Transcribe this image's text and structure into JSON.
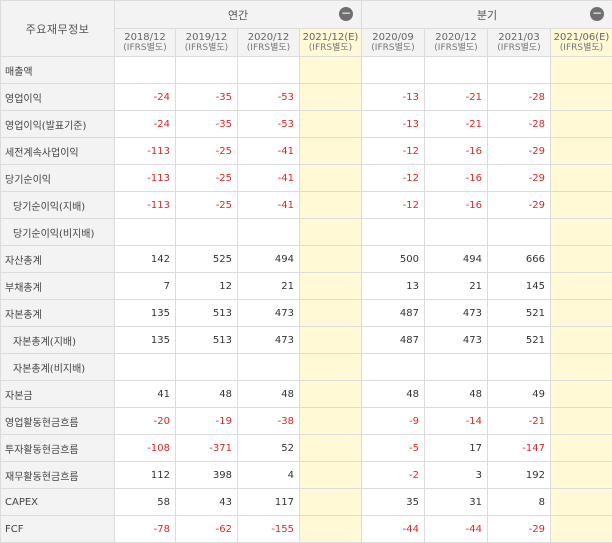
{
  "header": {
    "corner_label": "주요재무정보",
    "groups": [
      {
        "label": "연간",
        "collapse_icon": "minus-circle-icon"
      },
      {
        "label": "분기",
        "collapse_icon": "minus-circle-icon"
      }
    ],
    "periods": [
      {
        "date": "2018/12",
        "basis": "(IFRS별도)"
      },
      {
        "date": "2019/12",
        "basis": "(IFRS별도)"
      },
      {
        "date": "2020/12",
        "basis": "(IFRS별도)"
      },
      {
        "date": "2021/12(E)",
        "basis": "(IFRS별도)"
      },
      {
        "date": "2020/09",
        "basis": "(IFRS별도)"
      },
      {
        "date": "2020/12",
        "basis": "(IFRS별도)"
      },
      {
        "date": "2021/03",
        "basis": "(IFRS별도)"
      },
      {
        "date": "2021/06(E)",
        "basis": "(IFRS별도)"
      }
    ]
  },
  "rows": [
    {
      "label": "매출액",
      "indent": false,
      "values": [
        "",
        "",
        "",
        "",
        "",
        "",
        "",
        ""
      ]
    },
    {
      "label": "영업이익",
      "indent": false,
      "values": [
        "-24",
        "-35",
        "-53",
        "",
        "-13",
        "-21",
        "-28",
        ""
      ]
    },
    {
      "label": "영업이익(발표기준)",
      "indent": false,
      "values": [
        "-24",
        "-35",
        "-53",
        "",
        "-13",
        "-21",
        "-28",
        ""
      ]
    },
    {
      "label": "세전계속사업이익",
      "indent": false,
      "values": [
        "-113",
        "-25",
        "-41",
        "",
        "-12",
        "-16",
        "-29",
        ""
      ]
    },
    {
      "label": "당기순이익",
      "indent": false,
      "values": [
        "-113",
        "-25",
        "-41",
        "",
        "-12",
        "-16",
        "-29",
        ""
      ]
    },
    {
      "label": "당기순이익(지배)",
      "indent": true,
      "values": [
        "-113",
        "-25",
        "-41",
        "",
        "-12",
        "-16",
        "-29",
        ""
      ]
    },
    {
      "label": "당기순이익(비지배)",
      "indent": true,
      "values": [
        "",
        "",
        "",
        "",
        "",
        "",
        "",
        ""
      ]
    },
    {
      "label": "자산총계",
      "indent": false,
      "values": [
        "142",
        "525",
        "494",
        "",
        "500",
        "494",
        "666",
        ""
      ]
    },
    {
      "label": "부채총계",
      "indent": false,
      "values": [
        "7",
        "12",
        "21",
        "",
        "13",
        "21",
        "145",
        ""
      ]
    },
    {
      "label": "자본총계",
      "indent": false,
      "values": [
        "135",
        "513",
        "473",
        "",
        "487",
        "473",
        "521",
        ""
      ]
    },
    {
      "label": "자본총계(지배)",
      "indent": true,
      "values": [
        "135",
        "513",
        "473",
        "",
        "487",
        "473",
        "521",
        ""
      ]
    },
    {
      "label": "자본총계(비지배)",
      "indent": true,
      "values": [
        "",
        "",
        "",
        "",
        "",
        "",
        "",
        ""
      ]
    },
    {
      "label": "자본금",
      "indent": false,
      "values": [
        "41",
        "48",
        "48",
        "",
        "48",
        "48",
        "49",
        ""
      ]
    },
    {
      "label": "영업활동현금흐름",
      "indent": false,
      "values": [
        "-20",
        "-19",
        "-38",
        "",
        "-9",
        "-14",
        "-21",
        ""
      ]
    },
    {
      "label": "투자활동현금흐름",
      "indent": false,
      "values": [
        "-108",
        "-371",
        "52",
        "",
        "-5",
        "17",
        "-147",
        ""
      ]
    },
    {
      "label": "재무활동현금흐름",
      "indent": false,
      "values": [
        "112",
        "398",
        "4",
        "",
        "-2",
        "3",
        "192",
        ""
      ]
    },
    {
      "label": "CAPEX",
      "indent": false,
      "values": [
        "58",
        "43",
        "117",
        "",
        "35",
        "31",
        "8",
        ""
      ]
    },
    {
      "label": "FCF",
      "indent": false,
      "values": [
        "-78",
        "-62",
        "-155",
        "",
        "-44",
        "-44",
        "-29",
        ""
      ]
    }
  ],
  "colors": {
    "negative": "#e0232a",
    "estimate_bg": "#fff9d6",
    "header_bg": "#f3f3f3",
    "border": "#dcdcdc"
  }
}
